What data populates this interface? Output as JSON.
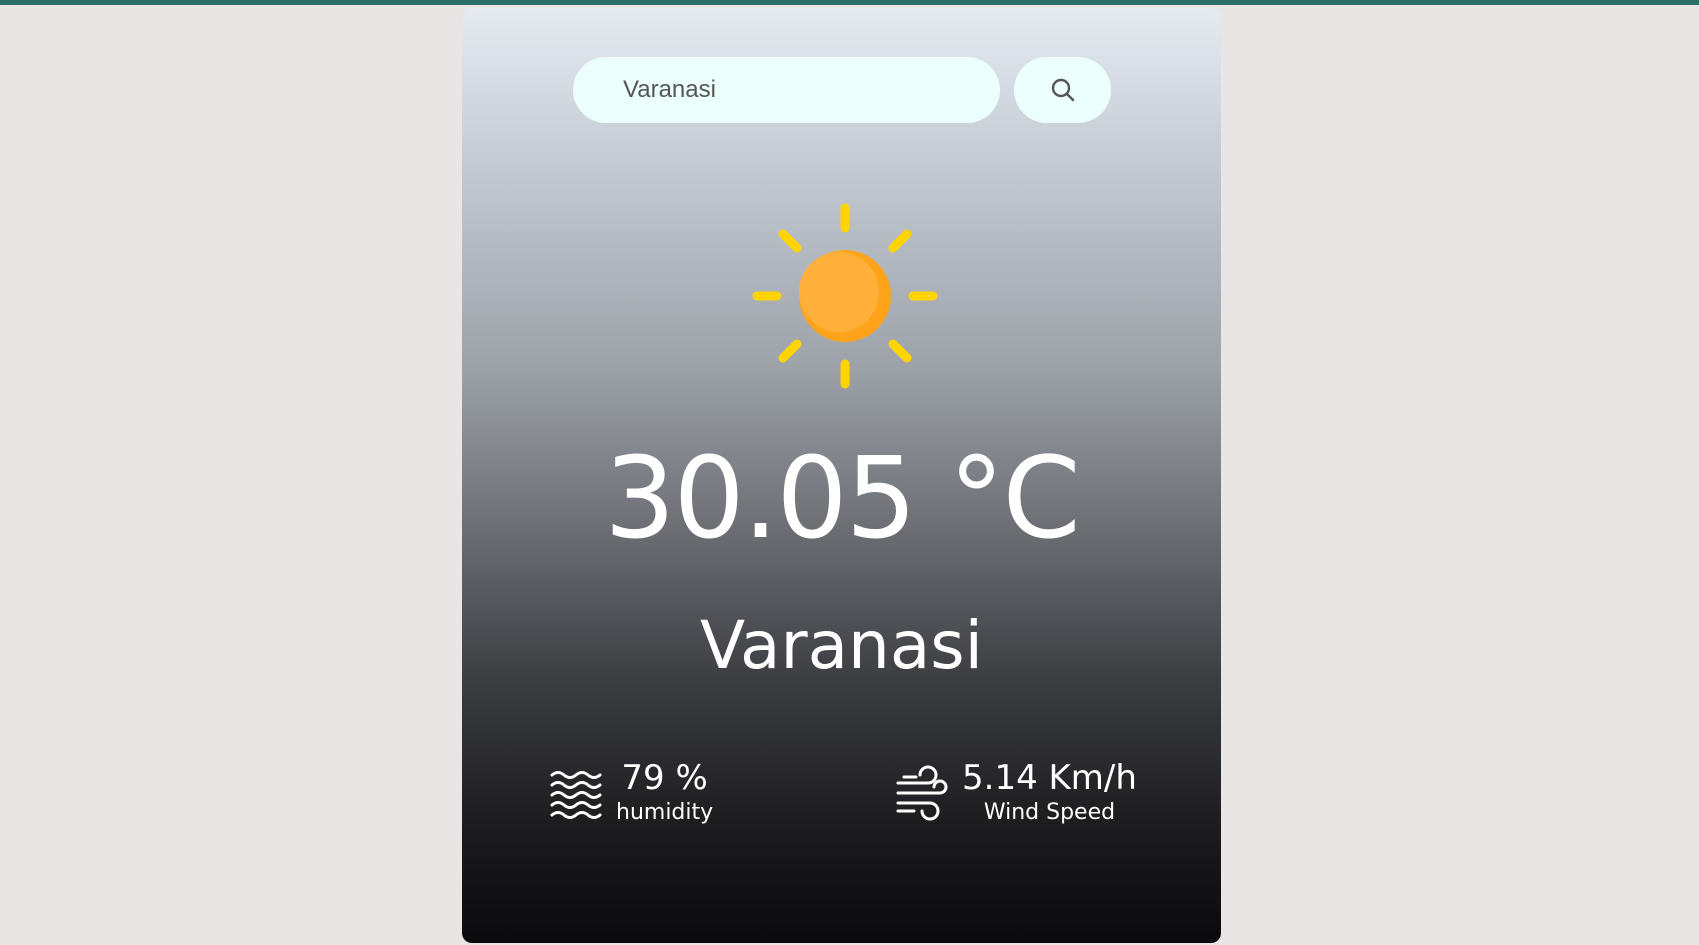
{
  "search": {
    "value": "Varanasi",
    "button_icon": "search-icon"
  },
  "weather": {
    "condition_icon": "sun-icon",
    "temperature": "30.05 °C",
    "city": "Varanasi"
  },
  "details": {
    "humidity": {
      "icon": "humidity-icon",
      "value": "79 %",
      "label": "humidity"
    },
    "wind": {
      "icon": "wind-icon",
      "value": "5.14 Km/h",
      "label": "Wind Speed"
    }
  },
  "colors": {
    "page_background": "#e9e5e4",
    "top_border": "#2e6f6a",
    "search_background": "#ebfffc",
    "sun_body": "#ffb03b",
    "sun_rays": "#ffd400",
    "text": "#ffffff"
  }
}
